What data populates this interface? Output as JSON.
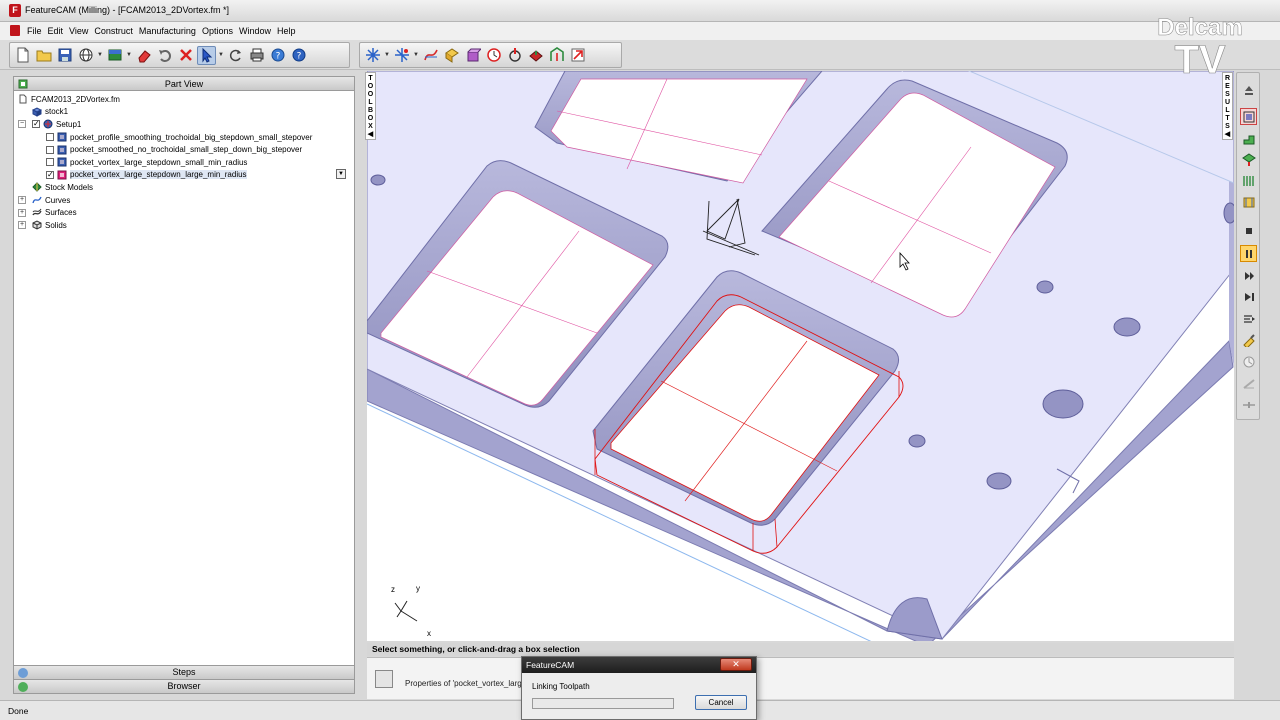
{
  "window": {
    "title": "FeatureCAM (Milling) - [FCAM2013_2DVortex.fm *]",
    "controls": [
      "—",
      "□",
      "✕"
    ]
  },
  "menu": {
    "items": [
      "File",
      "Edit",
      "View",
      "Construct",
      "Manufacturing",
      "Options",
      "Window",
      "Help"
    ]
  },
  "toolbar": {
    "groups": [
      [
        "new-icon",
        "open-icon",
        "save-icon",
        "globe-icon",
        "stock-icon",
        "eraser-icon",
        "undo-icon",
        "delete-icon",
        "select-arrow-icon",
        "rotate-icon",
        "print-icon",
        "help-context-icon",
        "help-icon"
      ],
      [
        "wizard-icon",
        "feature-wizard-icon",
        "curve-icon",
        "pocket-icon",
        "solid-icon",
        "animate-icon",
        "centerline-icon",
        "simulation-3d-icon",
        "toolpath-icon",
        "export-icon"
      ]
    ]
  },
  "left_panel": {
    "header": "Part View",
    "tree": [
      {
        "label": "FCAM2013_2DVortex.fm",
        "depth": 0,
        "icon": "document-icon"
      },
      {
        "label": "stock1",
        "depth": 1,
        "icon": "stock-icon"
      },
      {
        "label": "Setup1",
        "depth": 1,
        "icon": "setup-icon",
        "expander": "−",
        "checked": true
      },
      {
        "label": "pocket_profile_smoothing_trochoidal_big_stepdown_small_stepover",
        "depth": 2,
        "icon": "feature-icon",
        "checked": false
      },
      {
        "label": "pocket_smoothed_no_trochoidal_small_step_down_big_stepover",
        "depth": 2,
        "icon": "feature-icon",
        "checked": false
      },
      {
        "label": "pocket_vortex_large_stepdown_small_min_radius",
        "depth": 2,
        "icon": "feature-icon",
        "checked": false
      },
      {
        "label": "pocket_vortex_large_stepdown_large_min_radius",
        "depth": 2,
        "icon": "feature-active-icon",
        "checked": true,
        "selected": true
      },
      {
        "label": "Stock Models",
        "depth": 1,
        "icon": "stock-models-icon"
      },
      {
        "label": "Curves",
        "depth": 1,
        "icon": "curves-icon",
        "expander": "+"
      },
      {
        "label": "Surfaces",
        "depth": 1,
        "icon": "surfaces-icon",
        "expander": "+"
      },
      {
        "label": "Solids",
        "depth": 1,
        "icon": "solids-icon",
        "expander": "+"
      }
    ],
    "bottom_tabs": [
      "Steps",
      "Browser"
    ]
  },
  "side_strips": {
    "toolbox": "TOOLBOX",
    "results": "RESULTS"
  },
  "viewport": {
    "axes": {
      "x": "x",
      "y": "y",
      "z": "z"
    }
  },
  "logo": {
    "line1": "Delcam",
    "line2": "TV"
  },
  "prompt": "Select something, or click-and-drag a box selection",
  "properties_text": "Properties of 'pocket_vortex_large",
  "status": "Done",
  "dialog": {
    "title": "FeatureCAM",
    "message": "Linking Toolpath",
    "cancel": "Cancel",
    "close": "✕",
    "progress": 0.0
  },
  "colors": {
    "accent": "#c0141b",
    "part_face": "#e6e6fb",
    "part_edge": "#8080b4",
    "toolpath": "#e0207a",
    "selected_feature": "#e01010"
  }
}
